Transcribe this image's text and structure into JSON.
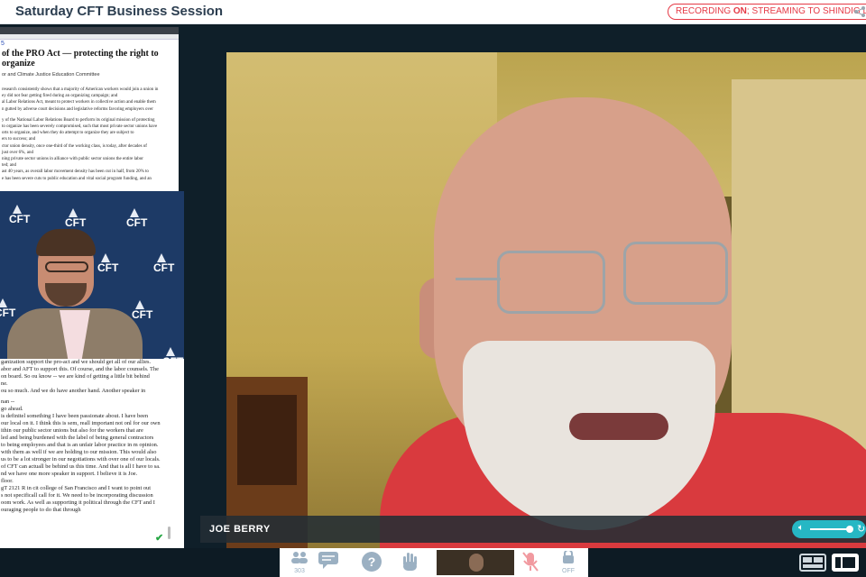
{
  "header": {
    "title": "Saturday CFT Business Session",
    "recording_prefix": "RECORDING ",
    "recording_on": "ON",
    "recording_suffix": "; STREAMING TO SHINDIG LIVE"
  },
  "document": {
    "num": "5",
    "heading": "of the PRO Act — protecting the right to organize",
    "sub": "or and Climate Justice Education Committee",
    "lines": [
      "research consistently shows that a majority of American workers would join a union in",
      "ey did not fear getting fired during an organizing campaign; and",
      "al Labor Relations Act, meant to protect workers in collective action and enable them",
      "n gutted by adverse court decisions and legislative reforms favoring employers over",
      "",
      "y of the National Labor Relations Board to perform its original mission of protecting",
      "to organize has been severely compromised, such that most private sector unions have",
      "orts to organize, and when they do attempt to organize they are subject to",
      "ers to success; and",
      "ctor union density, once one-third of the working class, is today, after decades of",
      "just over 6%, and",
      "ning private sector unions in alliance with public sector unions the entire labor",
      "ted; and",
      "ast 40 years, as overall labor movement density has been cut in half, from 20% to",
      "e has been severe cuts to public education and vital social program funding, and an"
    ]
  },
  "chat": {
    "lines": [
      "ganization support the pro-act and we should get all of our allies.",
      "abor and AFT to support this.  Of course, and the labor counsels.  The",
      "on board.  So ou know -- we are kind of getting a little bit behind",
      "ne.",
      "ou so much.  And we do have another hand.  Another speaker in",
      "",
      "nan --",
      "go ahead.",
      "is definitel something I have been passionate about.  I have been",
      "our local on it.  I think this is sem, reall important not onl for our own",
      "ithin our public sector unions but also for the workers that are",
      "led and being burdened with the label of being general contractors",
      "to being employees and that is an unfair labor practice in m opinion.",
      "with them as well if we are holding to our mission.  This would also",
      "us to be a lot stronger in our negotiations with over one of our locals.",
      "of CFT can actuall be behind us this time.  And that is all I have to sa.",
      "nd we have one more speaker in support.  I believe it is Joe.",
      "floor.",
      "gT 2121 R in cit college of San Francisco and I want to point out",
      "s not specificall call for it.  We need to be incorporating discussion",
      "oom work.  As well as supporting it political through the CFT and I",
      "ouraging people to do that through"
    ]
  },
  "person_panel": {
    "logo_text": "CFT"
  },
  "main_video": {
    "speaker_name": "JOE BERRY"
  },
  "controls": {
    "attendee_count": "303",
    "icons": [
      "people-icon",
      "chat-icon",
      "help-icon",
      "raise-hand-icon",
      "mic-off-icon",
      "power-off-icon"
    ],
    "off_label": "OFF"
  },
  "colors": {
    "accent": "#26b7c4",
    "recording": "#e53945",
    "header_text": "#2c3e50"
  }
}
